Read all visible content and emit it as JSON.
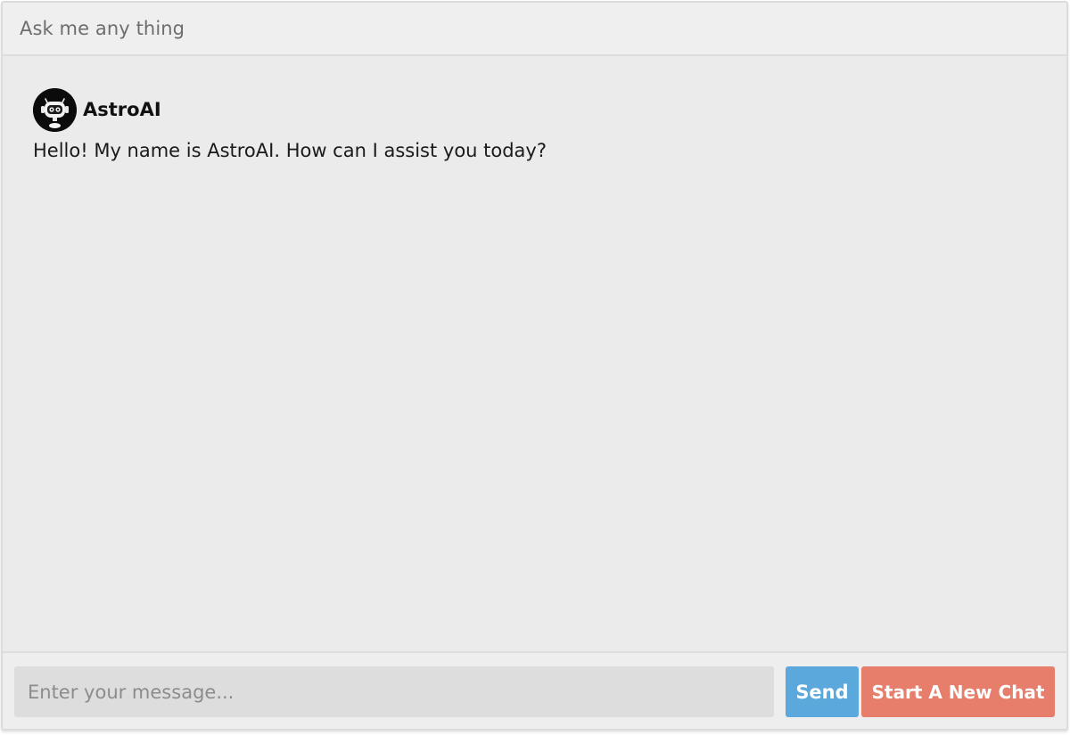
{
  "header": {
    "title": "Ask me any thing"
  },
  "conversation": {
    "messages": [
      {
        "author": "AstroAI",
        "avatar_icon": "robot-icon",
        "text": "Hello! My name is AstroAI. How can I assist you today?"
      }
    ]
  },
  "composer": {
    "placeholder": "Enter your message...",
    "value": "",
    "send_label": "Send",
    "new_chat_label": "Start A New Chat"
  },
  "colors": {
    "send": "#5ba8dc",
    "new_chat": "#e67e6b",
    "background": "#ebebeb"
  }
}
